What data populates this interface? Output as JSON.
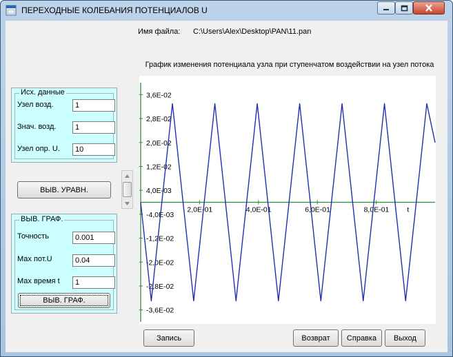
{
  "window": {
    "title": "ПЕРЕХОДНЫЕ КОЛЕБАНИЯ ПОТЕНЦИАЛОВ  U",
    "icon": "app-icon",
    "controls": [
      "minimize-icon",
      "maximize-icon",
      "close-icon"
    ]
  },
  "file": {
    "label": "Имя файла:",
    "path": "C:\\Users\\Alex\\Desktop\\PAN\\11.pan"
  },
  "input_data": {
    "legend": "Исх. данные",
    "fields": [
      {
        "label": "Узел возд.",
        "value": "1"
      },
      {
        "label": "Знач. возд.",
        "value": "1"
      },
      {
        "label": "Узел опр. U.",
        "value": "10"
      }
    ]
  },
  "equation_button": "ВЫВ. УРАВН.",
  "graph_settings": {
    "legend": "ВЫВ. ГРАФ.",
    "fields": [
      {
        "label": "Точность",
        "value": "0.001"
      },
      {
        "label": "Мах пот.U",
        "value": "0.04"
      },
      {
        "label": "Мах время t",
        "value": "1"
      }
    ],
    "button": "ВЫВ. ГРАФ."
  },
  "bottom_buttons": {
    "save": "Запись",
    "back": "Возврат",
    "help": "Справка",
    "exit": "Выход"
  },
  "chart_data": {
    "type": "line",
    "title": "График изменения  потенциала  узла при ступенчатом воздействии на узел потока",
    "xlabel": "t",
    "ylabel": "",
    "xlim": [
      0,
      1
    ],
    "ylim": [
      -0.04,
      0.04
    ],
    "y_ticks": [
      "3,6E-02",
      "2,8E-02",
      "2,0E-02",
      "1,2E-02",
      "4,0E-03",
      "-4,0E-03",
      "-1,2E-02",
      "-2,0E-02",
      "-2,8E-02",
      "-3,6E-02"
    ],
    "y_tick_values": [
      0.036,
      0.028,
      0.02,
      0.012,
      0.004,
      -0.004,
      -0.012,
      -0.02,
      -0.028,
      -0.036
    ],
    "x_ticks": [
      "2,0E-01",
      "4,0E-01",
      "6,0E-01",
      "8,0E-01"
    ],
    "x_tick_values": [
      0.2,
      0.4,
      0.6,
      0.8
    ],
    "series": [
      {
        "color": "#1f2fb0",
        "x": [
          0.0,
          0.036,
          0.072,
          0.108,
          0.144,
          0.18,
          0.216,
          0.252,
          0.288,
          0.324,
          0.36,
          0.396,
          0.432,
          0.468,
          0.504,
          0.54,
          0.576,
          0.612,
          0.648,
          0.684,
          0.72,
          0.756,
          0.792,
          0.828,
          0.864,
          0.9,
          0.936,
          0.972,
          1.0
        ],
        "y": [
          0.0,
          -0.033,
          0.0,
          0.033,
          0.0,
          -0.033,
          0.0,
          0.033,
          0.0,
          -0.033,
          0.0,
          0.033,
          0.0,
          -0.033,
          0.0,
          0.033,
          0.0,
          -0.033,
          0.0,
          0.033,
          0.0,
          -0.033,
          0.0,
          0.033,
          0.0,
          -0.033,
          0.0,
          0.033,
          0.02
        ]
      }
    ],
    "axis_color": "#2e8b2e"
  }
}
